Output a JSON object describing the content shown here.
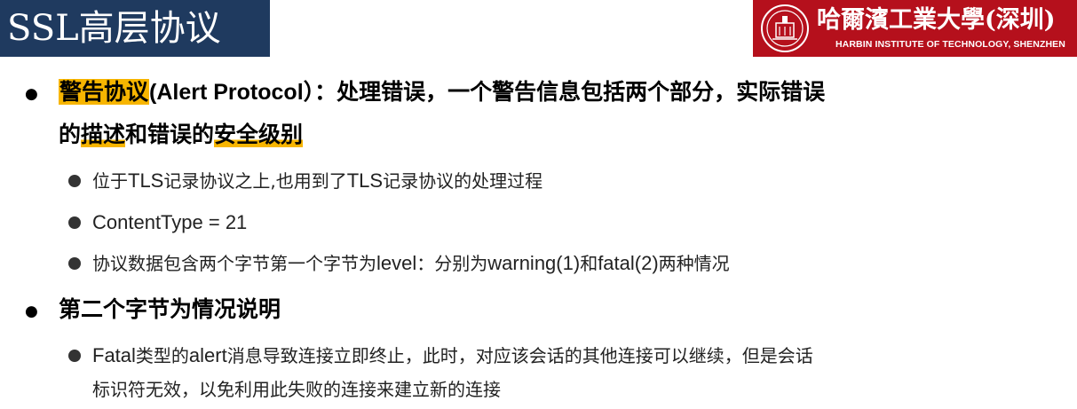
{
  "slide": {
    "title": "SSL高层协议"
  },
  "logo": {
    "chinese_name": "哈爾濱工業大學(深圳)",
    "english_name": "HARBIN INSTITUTE OF TECHNOLOGY, SHENZHEN"
  },
  "bullets": [
    {
      "highlight_label": "警告协议",
      "en_label": "(Alert Protocol",
      "line1_rest": "）：处理错误，一个警告信息包括两个部分，实际错误",
      "line2_prefix": "的",
      "line2_part1": "描述",
      "line2_middle": "和错误的",
      "line2_part2": "安全级别",
      "sub_items": [
        {
          "text_a": "位于",
          "en_a": "TLS",
          "text_b": "记录协议之上,也用到了",
          "en_b": "TLS",
          "text_c": "记录协议的处理过程"
        },
        {
          "en_a": "ContentType = 21"
        },
        {
          "text_a": "协议数据包含两个字节第一个字节为",
          "en_a": "level",
          "text_b": "：分别为",
          "en_b": "warning(1)",
          "text_c": "和",
          "en_c": "fatal(2)",
          "text_d": "两种情况"
        }
      ]
    },
    {
      "label": "第二个字节为情况说明",
      "sub_items": [
        {
          "en_a": "Fatal",
          "text_a": "类型的",
          "en_b": "alert",
          "text_b": "消息导致连接立即终止，此时，对应该会话的其他连接可以继续，但是会话",
          "line2": "标识符无效，以免利用此失败的连接来建立新的连接"
        }
      ]
    }
  ]
}
